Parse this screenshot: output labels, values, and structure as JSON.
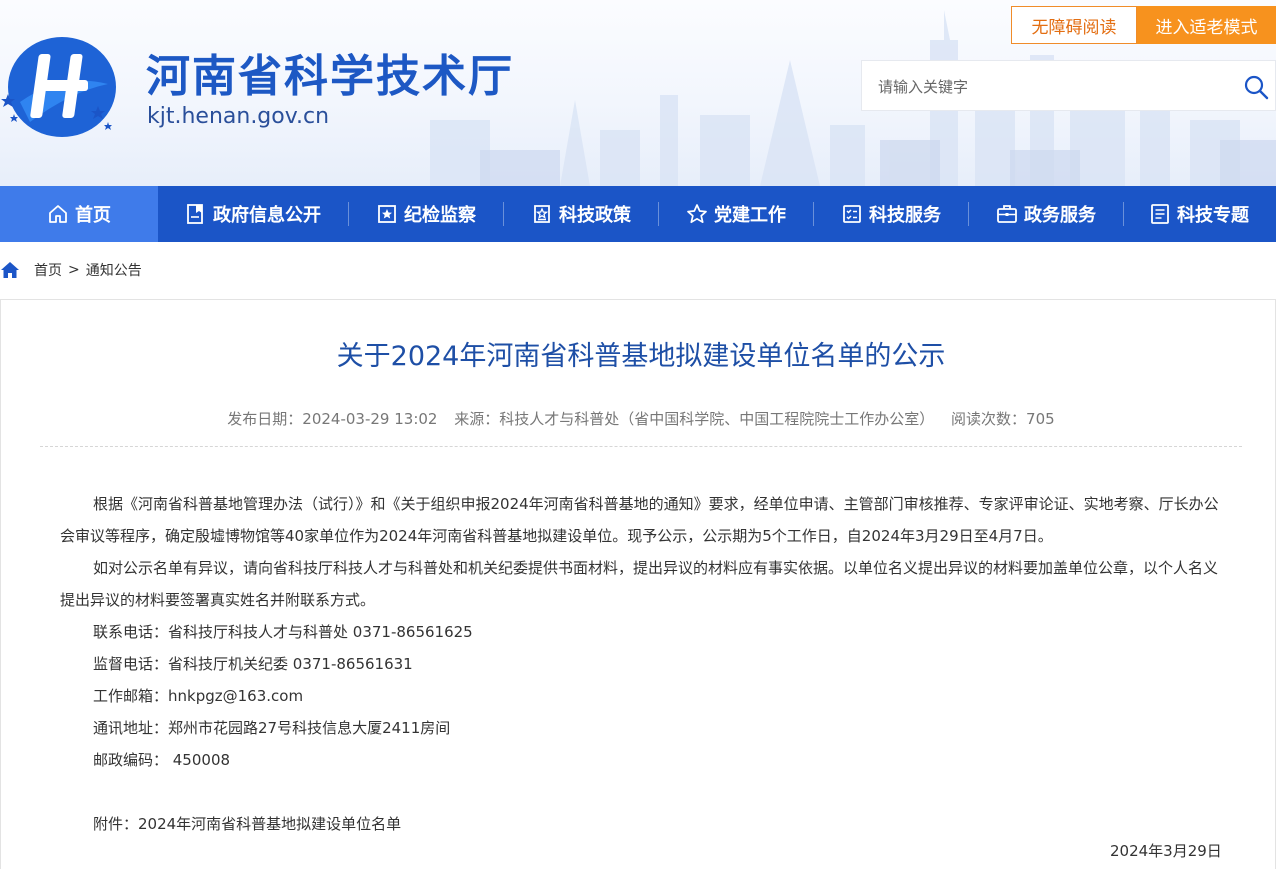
{
  "header": {
    "site_title": "河南省科学技术厅",
    "site_domain": "kjt.henan.gov.cn",
    "accessibility_label": "无障碍阅读",
    "elder_mode_label": "进入适老模式",
    "search_placeholder": "请输入关键字"
  },
  "nav": {
    "items": [
      {
        "label": "首页",
        "icon": "home-icon",
        "active": true
      },
      {
        "label": "政府信息公开",
        "icon": "bookmark-doc-icon"
      },
      {
        "label": "纪检监察",
        "icon": "inspect-icon"
      },
      {
        "label": "科技政策",
        "icon": "policy-icon"
      },
      {
        "label": "党建工作",
        "icon": "star-icon"
      },
      {
        "label": "科技服务",
        "icon": "checklist-icon"
      },
      {
        "label": "政务服务",
        "icon": "briefcase-icon"
      },
      {
        "label": "科技专题",
        "icon": "topic-doc-icon"
      }
    ]
  },
  "breadcrumb": {
    "home": "首页",
    "separator": ">",
    "current": "通知公告"
  },
  "article": {
    "title": "关于2024年河南省科普基地拟建设单位名单的公示",
    "meta": {
      "publish_date": "发布日期：2024-03-29 13:02",
      "source": "来源：科技人才与科普处（省中国科学院、中国工程院院士工作办公室）",
      "views": "阅读次数：705"
    },
    "paragraph1": "根据《河南省科普基地管理办法（试行）》和《关于组织申报2024年河南省科普基地的通知》要求，经单位申请、主管部门审核推荐、专家评审论证、实地考察、厅长办公会审议等程序，确定殷墟博物馆等40家单位作为2024年河南省科普基地拟建设单位。现予公示，公示期为5个工作日，自2024年3月29日至4月7日。",
    "paragraph2": "如对公示名单有异议，请向省科技厅科技人才与科普处和机关纪委提供书面材料，提出异议的材料应有事实依据。以单位名义提出异议的材料要加盖单位公章，以个人名义提出异议的材料要签署真实姓名并附联系方式。",
    "contact_phone": "联系电话：省科技厅科技人才与科普处   0371-86561625",
    "supervise_phone": "监督电话：省科技厅机关纪委   0371-86561631",
    "email": "工作邮箱：hnkpgz@163.com",
    "address": "通讯地址：郑州市花园路27号科技信息大厦2411房间",
    "postcode": "邮政编码：  450008",
    "attachment": "附件：2024年河南省科普基地拟建设单位名单",
    "date": "2024年3月29日"
  },
  "colors": {
    "brand_blue": "#1b55c7",
    "nav_active": "#3f7bea",
    "title_blue": "#1e4fa6",
    "accent_orange": "#f7921e"
  }
}
